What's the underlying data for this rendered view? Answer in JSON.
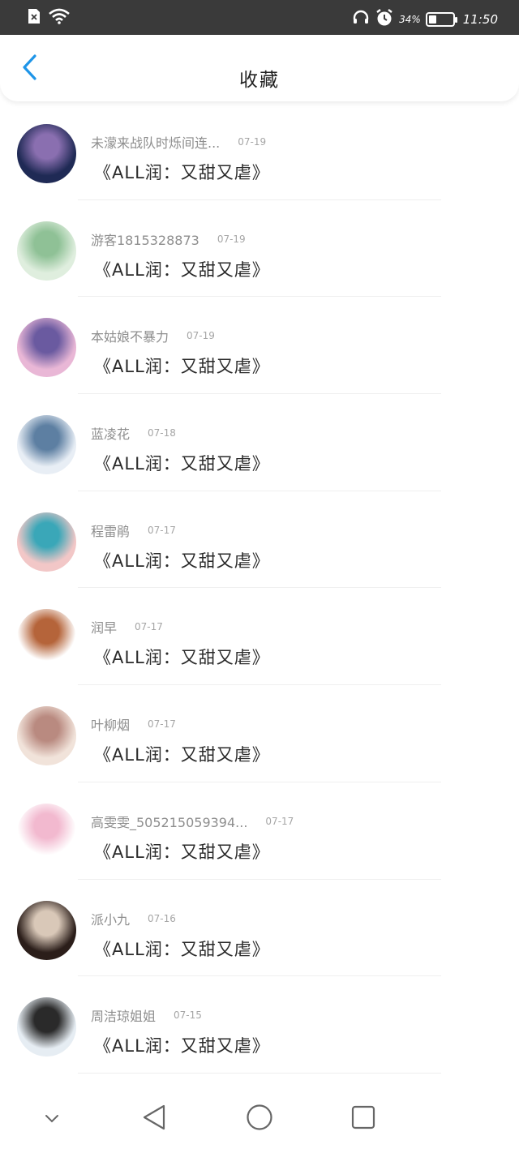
{
  "status_bar": {
    "battery_percent": "34%",
    "battery_level": 0.34,
    "time": "11:50"
  },
  "header": {
    "title": "收藏"
  },
  "favorites": [
    {
      "author": "未濛来战队时烁间连...",
      "date": "07-19",
      "title": "《ALL润：又甜又虐》",
      "avatar_colors": [
        "#1f2a55",
        "#8a6fb0"
      ]
    },
    {
      "author": "游客1815328873",
      "date": "07-19",
      "title": "《ALL润：又甜又虐》",
      "avatar_colors": [
        "#dfeede",
        "#8fc196"
      ]
    },
    {
      "author": "本姑娘不暴力",
      "date": "07-19",
      "title": "《ALL润：又甜又虐》",
      "avatar_colors": [
        "#e9b7d6",
        "#6a5aa0"
      ]
    },
    {
      "author": "蓝凌花",
      "date": "07-18",
      "title": "《ALL润：又甜又虐》",
      "avatar_colors": [
        "#e8eef5",
        "#5d7fa2"
      ]
    },
    {
      "author": "程雷鹃",
      "date": "07-17",
      "title": "《ALL润：又甜又虐》",
      "avatar_colors": [
        "#f2c7c7",
        "#3aa7b8"
      ]
    },
    {
      "author": "润早",
      "date": "07-17",
      "title": "《ALL润：又甜又虐》",
      "avatar_colors": [
        "#ffffff",
        "#b5643a"
      ]
    },
    {
      "author": "叶柳烟",
      "date": "07-17",
      "title": "《ALL润：又甜又虐》",
      "avatar_colors": [
        "#f1e3da",
        "#b98a80"
      ]
    },
    {
      "author": "高雯雯_505215059394...",
      "date": "07-17",
      "title": "《ALL润：又甜又虐》",
      "avatar_colors": [
        "#ffffff",
        "#f2b9cf"
      ]
    },
    {
      "author": "派小九",
      "date": "07-16",
      "title": "《ALL润：又甜又虐》",
      "avatar_colors": [
        "#2b1e1a",
        "#d9c8b8"
      ]
    },
    {
      "author": "周洁琼姐姐",
      "date": "07-15",
      "title": "《ALL润：又甜又虐》",
      "avatar_colors": [
        "#e6edf3",
        "#2a2a2a"
      ]
    }
  ]
}
